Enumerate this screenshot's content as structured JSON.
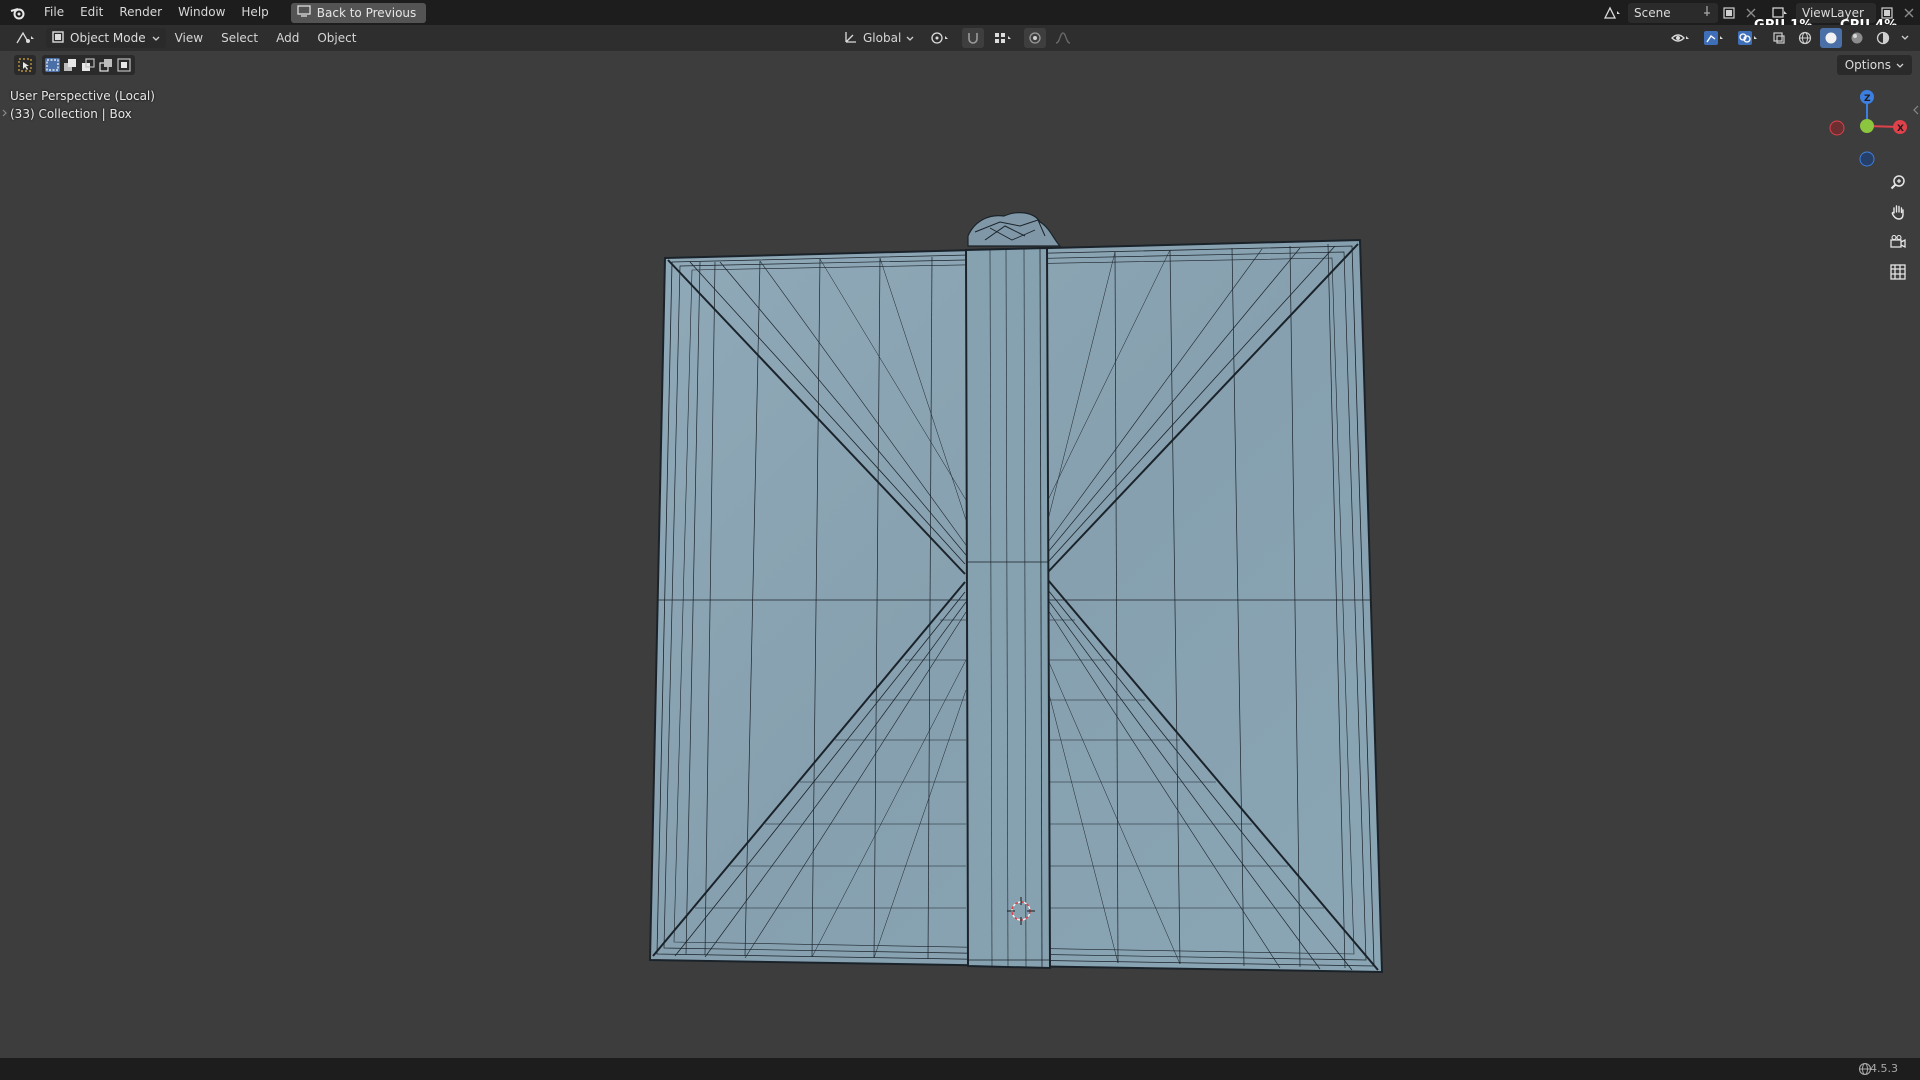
{
  "menubar": {
    "items": [
      "File",
      "Edit",
      "Render",
      "Window",
      "Help"
    ],
    "back_button": "Back to Previous"
  },
  "scene": {
    "name": "Scene"
  },
  "view_layer": {
    "name": "ViewLayer"
  },
  "monitor": {
    "gpu": "GPU 1%",
    "cpu": "CPU 4%"
  },
  "viewport_header": {
    "mode": "Object Mode",
    "menus": [
      "View",
      "Select",
      "Add",
      "Object"
    ],
    "transform_orientation": "Global"
  },
  "options_label": "Options",
  "viewport_info": {
    "perspective": "User Perspective (Local)",
    "collection": "(33) Collection | Box"
  },
  "status": {
    "version": "4.5.3"
  },
  "colors": {
    "mesh_fill": "#8aa4b3",
    "wire": "#1b232a",
    "axis_x": "#e0414a",
    "axis_y": "#8cc63f",
    "axis_z": "#3d7fe0"
  }
}
